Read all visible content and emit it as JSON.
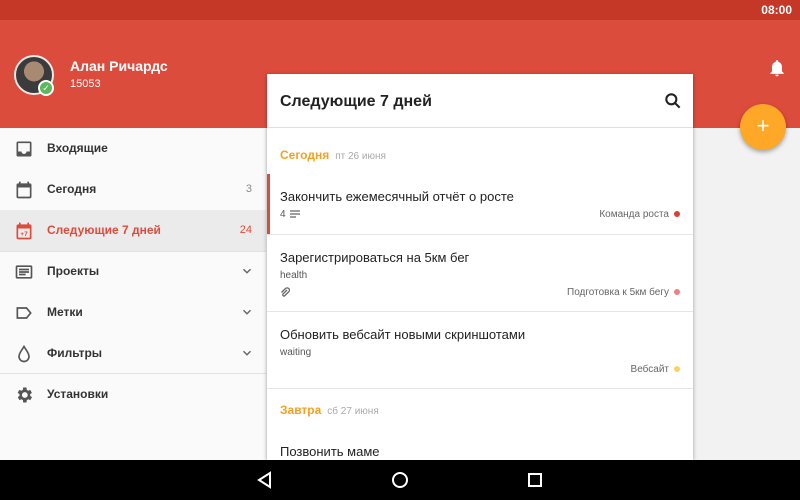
{
  "status_bar": {
    "time": "08:00"
  },
  "header": {
    "user_name": "Алан Ричардс",
    "karma": "15053"
  },
  "sidebar": {
    "items": [
      {
        "label": "Входящие",
        "count": "",
        "icon": "inbox-icon"
      },
      {
        "label": "Сегодня",
        "count": "3",
        "icon": "calendar-icon"
      },
      {
        "label": "Следующие 7 дней",
        "count": "24",
        "icon": "calendar-week-icon"
      },
      {
        "label": "Проекты",
        "count": "",
        "icon": "projects-icon"
      },
      {
        "label": "Метки",
        "count": "",
        "icon": "label-icon"
      },
      {
        "label": "Фильтры",
        "count": "",
        "icon": "filter-icon"
      },
      {
        "label": "Установки",
        "count": "",
        "icon": "gear-icon"
      }
    ]
  },
  "panel": {
    "title": "Следующие 7 дней",
    "sections": [
      {
        "day": "Сегодня",
        "date": "пт 26 июня"
      },
      {
        "day": "Завтра",
        "date": "сб 27 июня"
      }
    ],
    "tasks": [
      {
        "title": "Закончить ежемесячный отчёт о росте",
        "sub": "4",
        "project": "Команда роста",
        "color": "#db4035"
      },
      {
        "title": "Зарегистрироваться на 5км бег",
        "sub": "health",
        "project": "Подготовка к 5км бегу",
        "color": "#f08080"
      },
      {
        "title": "Обновить вебсайт новыми скриншотами",
        "sub": "waiting",
        "project": "Вебсайт",
        "color": "#fad165"
      },
      {
        "title": "Позвонить маме",
        "sub": "",
        "project": "",
        "color": ""
      }
    ]
  },
  "colors": {
    "accent": "#dc4c3d",
    "status_bar": "#c53727",
    "fab": "#ffa726",
    "section": "#f4a123"
  }
}
